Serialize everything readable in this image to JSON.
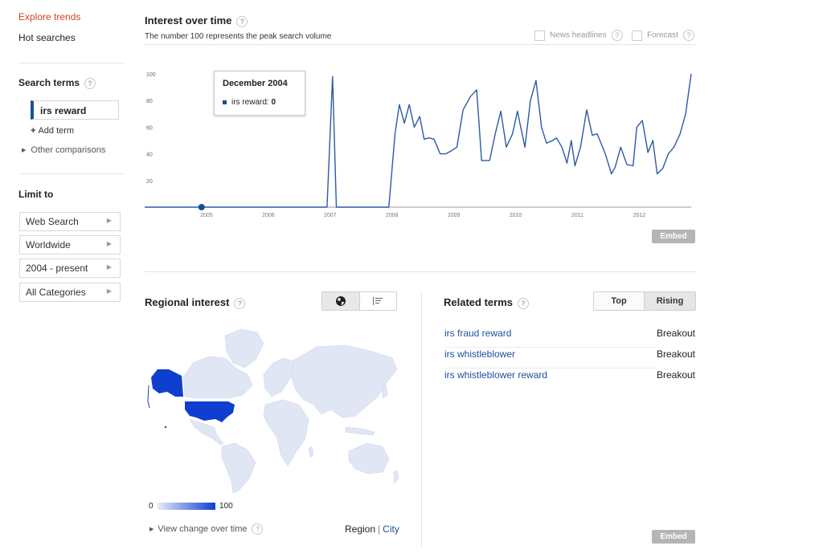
{
  "nav": {
    "explore": "Explore trends",
    "hot": "Hot searches",
    "search_terms": "Search terms",
    "term": "irs reward",
    "add_term": "Add term",
    "other": "Other comparisons",
    "limit_to": "Limit to",
    "filters": [
      "Web Search",
      "Worldwide",
      "2004 - present",
      "All Categories"
    ]
  },
  "interest": {
    "title": "Interest over time",
    "subtitle": "The number 100 represents the peak search volume",
    "news_headlines": "News headlines",
    "forecast": "Forecast",
    "embed": "Embed"
  },
  "tooltip": {
    "date": "December 2004",
    "label": "irs reward:",
    "value": "0"
  },
  "chart_data": {
    "type": "line",
    "title": "Interest over time",
    "xlabel": "",
    "ylabel": "",
    "y_ticks": [
      "20",
      "40",
      "60",
      "80",
      "100"
    ],
    "x_ticks": [
      "2005",
      "2006",
      "2007",
      "2008",
      "2009",
      "2010",
      "2011",
      "2012"
    ],
    "xlim": [
      2004.0,
      2012.84
    ],
    "ylim": [
      0,
      100
    ],
    "grid": false,
    "highlight_point": {
      "x": 2004.92,
      "y": 0
    },
    "series": [
      {
        "name": "irs reward",
        "color": "#2c5aa5",
        "x": [
          2004.0,
          2006.95,
          2007.04,
          2007.1,
          2007.2,
          2007.3,
          2007.95,
          2008.05,
          2008.12,
          2008.2,
          2008.28,
          2008.36,
          2008.45,
          2008.52,
          2008.6,
          2008.68,
          2008.78,
          2008.87,
          2008.95,
          2009.05,
          2009.15,
          2009.27,
          2009.37,
          2009.45,
          2009.58,
          2009.67,
          2009.76,
          2009.85,
          2009.95,
          2010.03,
          2010.15,
          2010.24,
          2010.33,
          2010.42,
          2010.5,
          2010.6,
          2010.66,
          2010.75,
          2010.83,
          2010.9,
          2010.96,
          2011.05,
          2011.15,
          2011.24,
          2011.32,
          2011.45,
          2011.55,
          2011.61,
          2011.7,
          2011.8,
          2011.9,
          2011.96,
          2012.05,
          2012.14,
          2012.22,
          2012.29,
          2012.38,
          2012.47,
          2012.56,
          2012.66,
          2012.75,
          2012.84
        ],
        "y": [
          0,
          0,
          98,
          0,
          0,
          0,
          0,
          55,
          77,
          63,
          77,
          60,
          68,
          51,
          52,
          51,
          40,
          40,
          42,
          45,
          73,
          83,
          88,
          35,
          35,
          55,
          72,
          45,
          55,
          72,
          45,
          80,
          95,
          60,
          48,
          50,
          52,
          45,
          33,
          50,
          31,
          45,
          73,
          54,
          55,
          40,
          25,
          30,
          45,
          32,
          31,
          60,
          65,
          41,
          50,
          25,
          29,
          40,
          45,
          55,
          70,
          100
        ]
      }
    ]
  },
  "regional": {
    "title": "Regional interest",
    "scale_min": "0",
    "scale_max": "100",
    "view_change": "View change over time",
    "region": "Region",
    "city": "City",
    "map_base_color": "#e1e6f5",
    "map_highlight_color": "#0f3fcf",
    "globe_icon": "globe-icon",
    "list_icon": "list-icon"
  },
  "related": {
    "title": "Related terms",
    "tab_top": "Top",
    "tab_rising": "Rising",
    "items": [
      {
        "term": "irs fraud reward",
        "value": "Breakout"
      },
      {
        "term": "irs whistleblower",
        "value": "Breakout"
      },
      {
        "term": "irs whistleblower reward",
        "value": "Breakout"
      }
    ],
    "embed": "Embed"
  },
  "colors": {
    "accent_red": "#d3432b",
    "link_blue": "#1f4e9e",
    "line_blue": "#2c5aa5"
  }
}
